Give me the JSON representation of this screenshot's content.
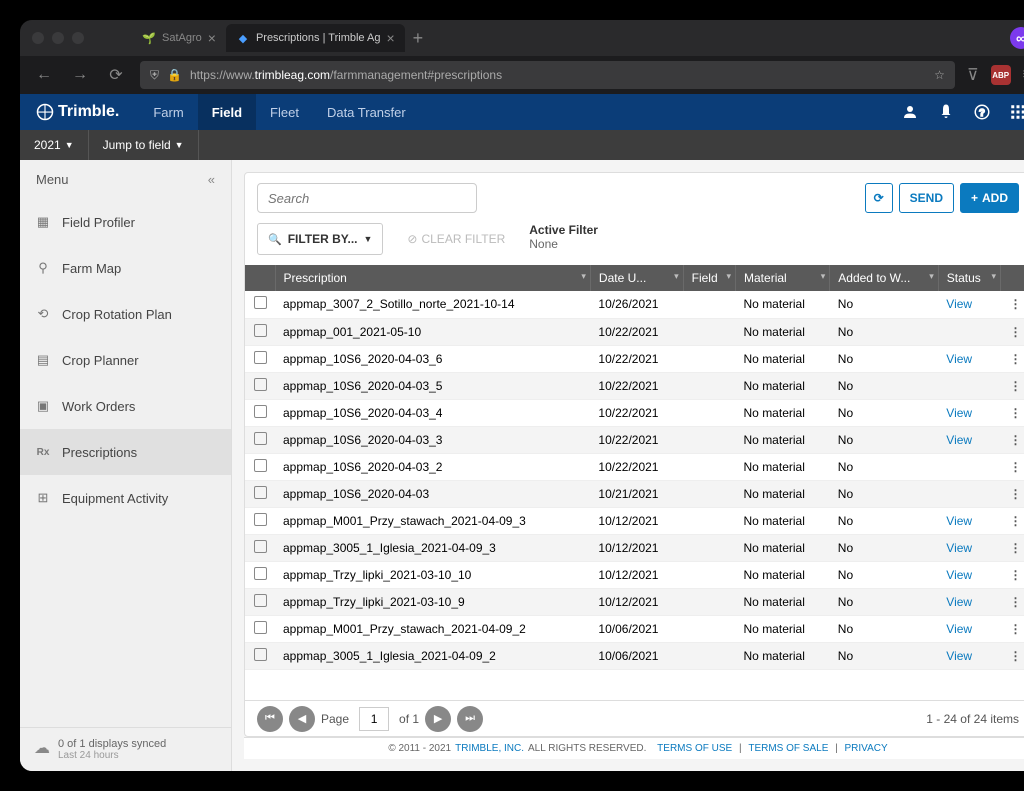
{
  "browser": {
    "tabs": [
      {
        "label": "SatAgro",
        "active": false
      },
      {
        "label": "Prescriptions | Trimble Ag",
        "active": true
      }
    ],
    "url_prefix": "https://www.",
    "url_bold": "trimbleag.com",
    "url_suffix": "/farmmanagement#prescriptions"
  },
  "header": {
    "logo": "Trimble.",
    "nav": [
      "Farm",
      "Field",
      "Fleet",
      "Data Transfer"
    ],
    "nav_active": 1
  },
  "subheader": {
    "year": "2021",
    "jump": "Jump to field"
  },
  "sidebar": {
    "title": "Menu",
    "items": [
      {
        "label": "Field Profiler"
      },
      {
        "label": "Farm Map"
      },
      {
        "label": "Crop Rotation Plan"
      },
      {
        "label": "Crop Planner"
      },
      {
        "label": "Work Orders"
      },
      {
        "label": "Prescriptions",
        "active": true,
        "prefix": "Rx"
      },
      {
        "label": "Equipment Activity"
      }
    ],
    "sync_line1": "0 of 1 displays synced",
    "sync_line2": "Last 24 hours"
  },
  "toolbar": {
    "search_placeholder": "Search",
    "send_label": "SEND",
    "add_label": "ADD",
    "filter_label": "FILTER BY...",
    "clear_label": "CLEAR FILTER",
    "active_filter_title": "Active Filter",
    "active_filter_value": "None"
  },
  "table": {
    "columns": [
      "Prescription",
      "Date U...",
      "Field",
      "Material",
      "Added to W...",
      "Status"
    ],
    "rows": [
      {
        "name": "appmap_3007_2_Sotillo_norte_2021-10-14",
        "date": "10/26/2021",
        "field": "",
        "material": "No material",
        "added": "No",
        "status": "View"
      },
      {
        "name": "appmap_001_2021-05-10",
        "date": "10/22/2021",
        "field": "",
        "material": "No material",
        "added": "No",
        "status": ""
      },
      {
        "name": "appmap_10S6_2020-04-03_6",
        "date": "10/22/2021",
        "field": "",
        "material": "No material",
        "added": "No",
        "status": "View"
      },
      {
        "name": "appmap_10S6_2020-04-03_5",
        "date": "10/22/2021",
        "field": "",
        "material": "No material",
        "added": "No",
        "status": ""
      },
      {
        "name": "appmap_10S6_2020-04-03_4",
        "date": "10/22/2021",
        "field": "",
        "material": "No material",
        "added": "No",
        "status": "View"
      },
      {
        "name": "appmap_10S6_2020-04-03_3",
        "date": "10/22/2021",
        "field": "",
        "material": "No material",
        "added": "No",
        "status": "View"
      },
      {
        "name": "appmap_10S6_2020-04-03_2",
        "date": "10/22/2021",
        "field": "",
        "material": "No material",
        "added": "No",
        "status": ""
      },
      {
        "name": "appmap_10S6_2020-04-03",
        "date": "10/21/2021",
        "field": "",
        "material": "No material",
        "added": "No",
        "status": ""
      },
      {
        "name": "appmap_M001_Przy_stawach_2021-04-09_3",
        "date": "10/12/2021",
        "field": "",
        "material": "No material",
        "added": "No",
        "status": "View"
      },
      {
        "name": "appmap_3005_1_Iglesia_2021-04-09_3",
        "date": "10/12/2021",
        "field": "",
        "material": "No material",
        "added": "No",
        "status": "View"
      },
      {
        "name": "appmap_Trzy_lipki_2021-03-10_10",
        "date": "10/12/2021",
        "field": "",
        "material": "No material",
        "added": "No",
        "status": "View"
      },
      {
        "name": "appmap_Trzy_lipki_2021-03-10_9",
        "date": "10/12/2021",
        "field": "",
        "material": "No material",
        "added": "No",
        "status": "View"
      },
      {
        "name": "appmap_M001_Przy_stawach_2021-04-09_2",
        "date": "10/06/2021",
        "field": "",
        "material": "No material",
        "added": "No",
        "status": "View"
      },
      {
        "name": "appmap_3005_1_Iglesia_2021-04-09_2",
        "date": "10/06/2021",
        "field": "",
        "material": "No material",
        "added": "No",
        "status": "View"
      }
    ]
  },
  "pager": {
    "page_label": "Page",
    "page_value": "1",
    "of_label": "of 1",
    "info": "1 - 24 of 24 items"
  },
  "footer": {
    "copyright": "© 2011 - 2021 ",
    "company": "TRIMBLE, INC.",
    "rights": " ALL RIGHTS RESERVED.",
    "links": [
      "TERMS OF USE",
      "TERMS OF SALE",
      "PRIVACY"
    ]
  }
}
